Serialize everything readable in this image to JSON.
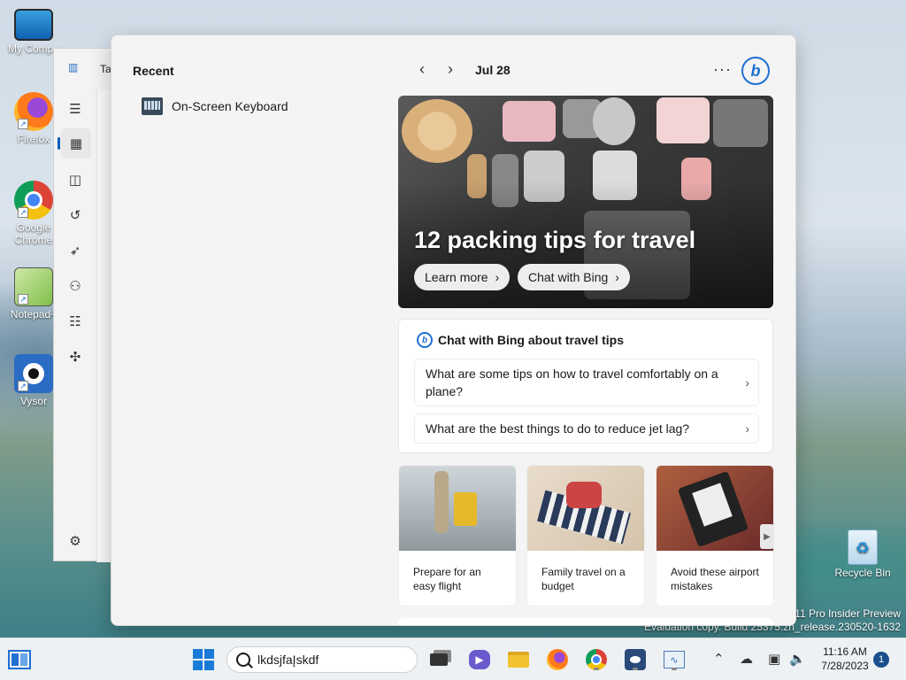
{
  "desktop": {
    "icons": [
      {
        "label": "My Compu",
        "icon": "computer-icon"
      },
      {
        "label": "Firefox",
        "icon": "firefox-icon"
      },
      {
        "label": "Google Chrome",
        "icon": "chrome-icon"
      },
      {
        "label": "Notepad+",
        "icon": "notepadpp-icon"
      },
      {
        "label": "Vysor",
        "icon": "vysor-icon"
      },
      {
        "label": "Recycle Bin",
        "icon": "recycle-bin-icon"
      }
    ],
    "watermark": {
      "line1": "s 11 Pro Insider Preview",
      "line2": "Evaluation copy. Build 25375.zn_release.230520-1632"
    }
  },
  "bg_window": {
    "title": "Ta",
    "nav_icons": [
      "hamburger-icon",
      "processes-icon",
      "performance-icon",
      "app-history-icon",
      "startup-icon",
      "users-icon",
      "details-icon",
      "services-icon",
      "settings-icon"
    ]
  },
  "search_panel": {
    "recent_title": "Recent",
    "recent_items": [
      {
        "label": "On-Screen Keyboard",
        "icon": "keyboard-icon"
      }
    ],
    "date": "Jul 28",
    "more": "···",
    "hero": {
      "title": "12 packing tips for travel",
      "buttons": [
        "Learn more",
        "Chat with Bing"
      ]
    },
    "chat": {
      "title": "Chat with Bing about travel tips",
      "questions": [
        "What are some tips on how to travel comfortably on a plane?",
        "What are the best things to do to reduce jet lag?"
      ]
    },
    "tiles": [
      {
        "caption": "Prepare for an easy flight"
      },
      {
        "caption": "Family travel on a budget"
      },
      {
        "caption": "Avoid these airport mistakes"
      }
    ]
  },
  "taskbar": {
    "search_value": "lkdsjfaĮskdf",
    "clock_time": "11:16 AM",
    "clock_date": "7/28/2023",
    "notification_count": "1",
    "apps": [
      "widgets-icon",
      "start-icon",
      "task-view-icon",
      "teams-chat-icon",
      "file-explorer-icon",
      "firefox-icon",
      "chrome-icon",
      "vysor-icon",
      "task-manager-icon"
    ]
  }
}
